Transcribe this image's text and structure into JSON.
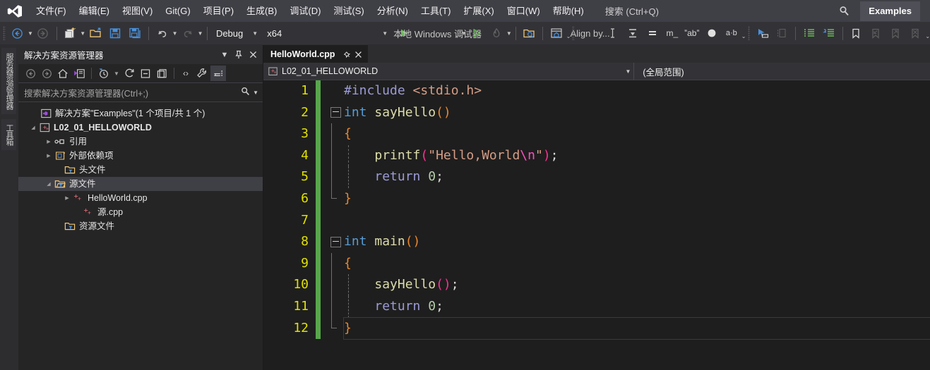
{
  "menu": {
    "logo_name": "visual-studio-logo",
    "items": [
      {
        "label": "文件(F)",
        "accel": "F"
      },
      {
        "label": "编辑(E)",
        "accel": "E"
      },
      {
        "label": "视图(V)",
        "accel": "V"
      },
      {
        "label": "Git(G)",
        "accel": "G"
      },
      {
        "label": "项目(P)",
        "accel": "P"
      },
      {
        "label": "生成(B)",
        "accel": "B"
      },
      {
        "label": "调试(D)",
        "accel": "D"
      },
      {
        "label": "测试(S)",
        "accel": "S"
      },
      {
        "label": "分析(N)",
        "accel": "N"
      },
      {
        "label": "工具(T)",
        "accel": "T"
      },
      {
        "label": "扩展(X)",
        "accel": "X"
      },
      {
        "label": "窗口(W)",
        "accel": "W"
      },
      {
        "label": "帮助(H)",
        "accel": "H"
      }
    ],
    "search_label": "搜索 (Ctrl+Q)",
    "solution_chip": "Examples"
  },
  "toolbar": {
    "back_label": "后退",
    "forward_label": "前进",
    "new_project_label": "新建项目",
    "open_label": "打开文件",
    "save_label": "保存",
    "save_all_label": "全部保存",
    "undo_label": "撤消",
    "redo_label": "恢复",
    "config_value": "Debug",
    "platform_value": "x64",
    "run_label": "本地 Windows 调试器",
    "start_without_debug_label": "开始执行(不调试)",
    "hot_reload_label": "热重载",
    "find_in_files_label": "在文件中查找",
    "solution_explorer_label": "解决方案资源管理器",
    "align_label": "Align by...",
    "insert_caret_label": "插入光标",
    "comment_label": "注释选定内容",
    "uncomment_label": "取消注释选定内容",
    "toggle_outlining_label": "折叠",
    "quotes_label": "引号",
    "breakpoint_label": "断点",
    "ab_label": "a.b",
    "increase_indent_label": "增加缩进",
    "decrease_indent_label": "减少缩进",
    "toggle_bookmark_label": "切换书签",
    "prev_bookmark_label": "上一书签",
    "next_bookmark_label": "下一书签",
    "clear_bookmarks_label": "清除书签"
  },
  "vertical_tabs": [
    {
      "label": "服务器资源管理器"
    },
    {
      "label": "工具箱"
    }
  ],
  "solution_explorer": {
    "title": "解决方案资源管理器",
    "search_placeholder": "搜索解决方案资源管理器(Ctrl+;)",
    "toolbar": {
      "back": "后退",
      "forward": "前进",
      "home": "主页",
      "pending_changes": "挂起的更改筛选器",
      "sync": "与活动文档同步",
      "refresh": "刷新",
      "collapse_all": "全部折叠",
      "show_all_files": "显示所有文件",
      "properties": "属性",
      "preview": "预览选定项目",
      "view_code": "查看代码"
    },
    "tree": [
      {
        "label": "解决方案\"Examples\"(1 个项目/共 1 个)",
        "icon": "solution-icon",
        "depth": 0,
        "expander": "",
        "bold": false,
        "selected": false
      },
      {
        "label": "L02_01_HELLOWORLD",
        "icon": "cpp-project-icon",
        "depth": 0,
        "expander": "expanded",
        "bold": true,
        "selected": false
      },
      {
        "label": "引用",
        "icon": "references-icon",
        "depth": 1,
        "expander": "collapsed",
        "bold": false,
        "selected": false
      },
      {
        "label": "外部依赖项",
        "icon": "external-dependencies-icon",
        "depth": 1,
        "expander": "collapsed",
        "bold": false,
        "selected": false
      },
      {
        "label": "头文件",
        "icon": "filter-folder-icon",
        "depth": 2,
        "expander": "",
        "bold": false,
        "selected": false
      },
      {
        "label": "源文件",
        "icon": "filter-folder-open-icon",
        "depth": 1,
        "expander": "expanded",
        "bold": false,
        "selected": true
      },
      {
        "label": "HelloWorld.cpp",
        "icon": "cpp-file-icon",
        "depth": 2,
        "expander": "collapsed",
        "bold": false,
        "selected": false
      },
      {
        "label": "源.cpp",
        "icon": "cpp-file-icon",
        "depth": 3,
        "expander": "",
        "bold": false,
        "selected": false
      },
      {
        "label": "资源文件",
        "icon": "filter-folder-icon",
        "depth": 2,
        "expander": "",
        "bold": false,
        "selected": false
      }
    ]
  },
  "editor": {
    "tab": {
      "filename": "HelloWorld.cpp",
      "pin_label": "固定",
      "close_label": "关闭"
    },
    "navbar": {
      "project": "L02_01_HELLOWORLD",
      "scope": "(全局范围)"
    },
    "line_numbers": [
      "1",
      "2",
      "3",
      "4",
      "5",
      "6",
      "7",
      "8",
      "9",
      "10",
      "11",
      "12"
    ],
    "code_lines": [
      {
        "n": "1",
        "tokens": [
          {
            "t": "#include",
            "c": "t-ppk"
          },
          {
            "t": " ",
            "c": "t-plain"
          },
          {
            "t": "<stdio.h>",
            "c": "t-inc"
          }
        ]
      },
      {
        "n": "2",
        "tokens": [
          {
            "t": "int",
            "c": "t-key"
          },
          {
            "t": " ",
            "c": "t-plain"
          },
          {
            "t": "sayHello",
            "c": "t-fn"
          },
          {
            "t": "()",
            "c": "t-paren1"
          }
        ]
      },
      {
        "n": "3",
        "tokens": [
          {
            "t": "{",
            "c": "t-brace"
          }
        ]
      },
      {
        "n": "4",
        "tokens": [
          {
            "t": "    ",
            "c": "t-plain"
          },
          {
            "t": "printf",
            "c": "t-fn"
          },
          {
            "t": "(",
            "c": "t-paren2"
          },
          {
            "t": "\"Hello,World",
            "c": "t-str"
          },
          {
            "t": "\\n",
            "c": "t-esc"
          },
          {
            "t": "\"",
            "c": "t-str"
          },
          {
            "t": ")",
            "c": "t-paren2"
          },
          {
            "t": ";",
            "c": "t-punc"
          }
        ]
      },
      {
        "n": "5",
        "tokens": [
          {
            "t": "    ",
            "c": "t-plain"
          },
          {
            "t": "return",
            "c": "t-key2"
          },
          {
            "t": " ",
            "c": "t-plain"
          },
          {
            "t": "0",
            "c": "t-num"
          },
          {
            "t": ";",
            "c": "t-punc"
          }
        ]
      },
      {
        "n": "6",
        "tokens": [
          {
            "t": "}",
            "c": "t-brace"
          }
        ]
      },
      {
        "n": "7",
        "tokens": []
      },
      {
        "n": "8",
        "tokens": [
          {
            "t": "int",
            "c": "t-key"
          },
          {
            "t": " ",
            "c": "t-plain"
          },
          {
            "t": "main",
            "c": "t-fn"
          },
          {
            "t": "()",
            "c": "t-paren1"
          }
        ]
      },
      {
        "n": "9",
        "tokens": [
          {
            "t": "{",
            "c": "t-brace"
          }
        ]
      },
      {
        "n": "10",
        "tokens": [
          {
            "t": "    ",
            "c": "t-plain"
          },
          {
            "t": "sayHello",
            "c": "t-fn"
          },
          {
            "t": "()",
            "c": "t-paren2"
          },
          {
            "t": ";",
            "c": "t-punc"
          }
        ]
      },
      {
        "n": "11",
        "tokens": [
          {
            "t": "    ",
            "c": "t-plain"
          },
          {
            "t": "return",
            "c": "t-key2"
          },
          {
            "t": " ",
            "c": "t-plain"
          },
          {
            "t": "0",
            "c": "t-num"
          },
          {
            "t": ";",
            "c": "t-punc"
          }
        ]
      },
      {
        "n": "12",
        "tokens": [
          {
            "t": "}",
            "c": "t-brace"
          }
        ]
      }
    ],
    "current_line": 12,
    "change_bar_color": "#57a64a"
  },
  "colors": {
    "menubar_bg": "#3f3f46",
    "toolbar_bg": "#333337",
    "panel_bg": "#252526",
    "editor_bg": "#1e1e1e",
    "selected_row": "#3f3f46",
    "line_number": "#e0e000"
  }
}
